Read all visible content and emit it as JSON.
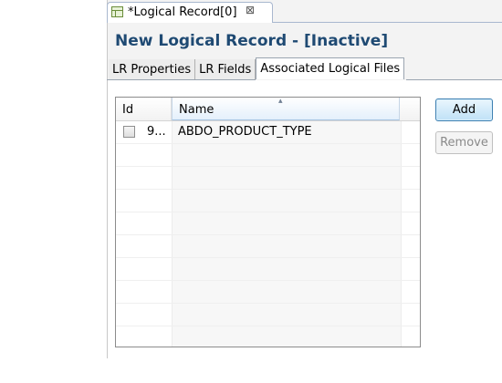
{
  "editor": {
    "tab_title": "*Logical Record[0]",
    "close_glyph": "⊠"
  },
  "form": {
    "title": "New Logical Record - [Inactive]"
  },
  "subtabs": [
    {
      "label": "LR Properties",
      "active": false
    },
    {
      "label": "LR Fields",
      "active": false
    },
    {
      "label": "Associated Logical Files",
      "active": true
    }
  ],
  "table": {
    "columns": {
      "id": "Id",
      "name": "Name"
    },
    "sort_glyph": "▴",
    "rows": [
      {
        "id": "9...",
        "name": "ABDO_PRODUCT_TYPE",
        "checked": false
      }
    ]
  },
  "buttons": {
    "add": "Add",
    "remove": "Remove"
  },
  "icons": {
    "editor_tab": "table-icon",
    "close": "close-icon",
    "sort": "sort-ascending-icon"
  }
}
